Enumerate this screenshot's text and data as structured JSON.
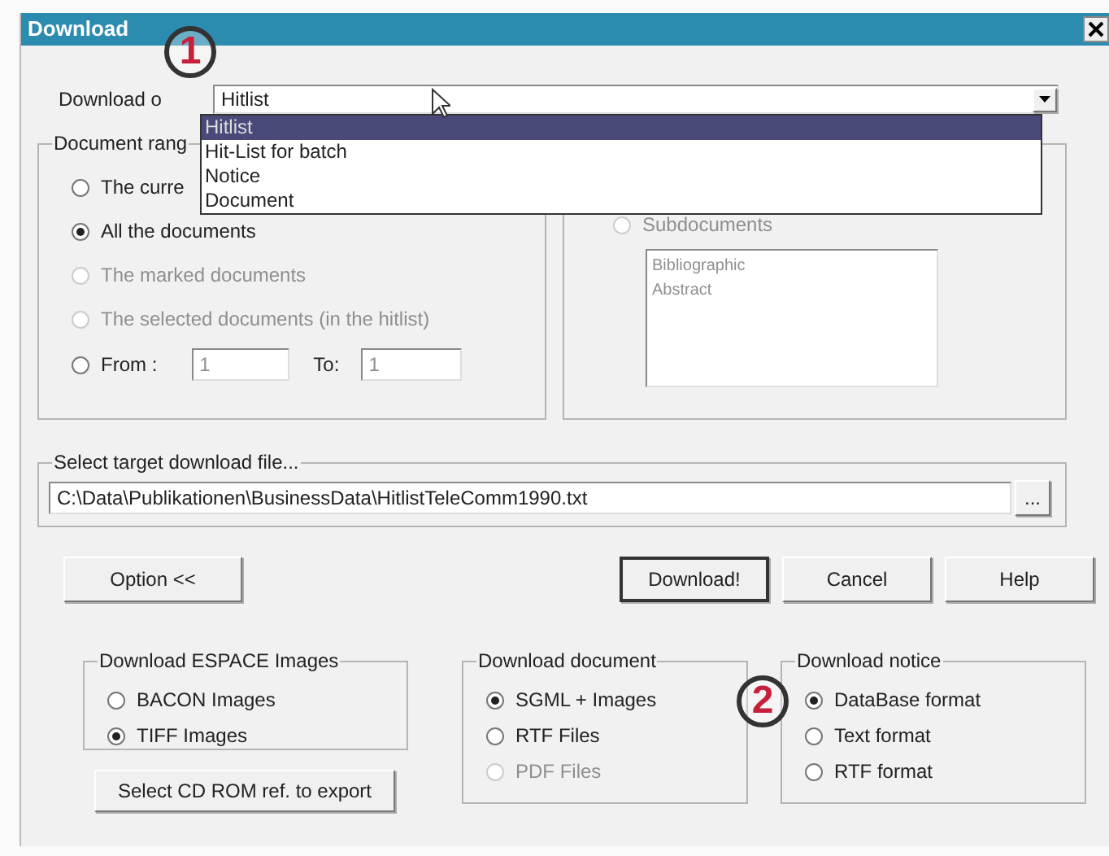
{
  "window": {
    "title": "Download"
  },
  "download_of": {
    "label": "Download o",
    "value": "Hitlist",
    "options": [
      {
        "label": "Hitlist",
        "selected": true
      },
      {
        "label": "Hit-List for batch",
        "selected": false
      },
      {
        "label": "Notice",
        "selected": false
      },
      {
        "label": "Document",
        "selected": false
      }
    ]
  },
  "callouts": [
    "1",
    "2"
  ],
  "document_range": {
    "label": "Document rang",
    "options": [
      {
        "kind": "radio",
        "label": "The curre",
        "checked": false,
        "disabled": false
      },
      {
        "kind": "radio",
        "label": "All the documents",
        "checked": true,
        "disabled": false
      },
      {
        "kind": "radio",
        "label": "The marked documents",
        "checked": false,
        "disabled": true
      },
      {
        "kind": "radio",
        "label": "The selected documents (in the hitlist)",
        "checked": false,
        "disabled": true
      },
      {
        "kind": "range",
        "label": "From :",
        "checked": false,
        "disabled": false,
        "from_value": "1",
        "to_label": "To:",
        "to_value": "1"
      }
    ]
  },
  "subdocuments": {
    "label": "Subdocuments",
    "checked": false,
    "disabled": true,
    "items": [
      "Bibliographic",
      "Abstract"
    ]
  },
  "target_file": {
    "label": "Select target download file...",
    "value": "C:\\Data\\Publikationen\\BusinessData\\HitlistTeleComm1990.txt",
    "browse": "..."
  },
  "option_button": "Option <<",
  "buttons": [
    {
      "label": "Download!",
      "default": true
    },
    {
      "label": "Cancel",
      "default": false
    },
    {
      "label": "Help",
      "default": false
    }
  ],
  "espace_images": {
    "label": "Download ESPACE Images",
    "options": [
      {
        "label": "BACON Images",
        "checked": false,
        "disabled": false
      },
      {
        "label": "TIFF Images",
        "checked": true,
        "disabled": false
      }
    ]
  },
  "cd_rom_button": "Select CD ROM ref. to export",
  "download_document": {
    "label": "Download document",
    "options": [
      {
        "label": "SGML + Images",
        "checked": true,
        "disabled": false
      },
      {
        "label": "RTF Files",
        "checked": false,
        "disabled": false
      },
      {
        "label": "PDF Files",
        "checked": false,
        "disabled": true
      }
    ]
  },
  "download_notice": {
    "label": "Download notice",
    "options": [
      {
        "label": "DataBase format",
        "checked": true,
        "disabled": false
      },
      {
        "label": "Text format",
        "checked": false,
        "disabled": false
      },
      {
        "label": "RTF format",
        "checked": false,
        "disabled": false
      }
    ]
  }
}
